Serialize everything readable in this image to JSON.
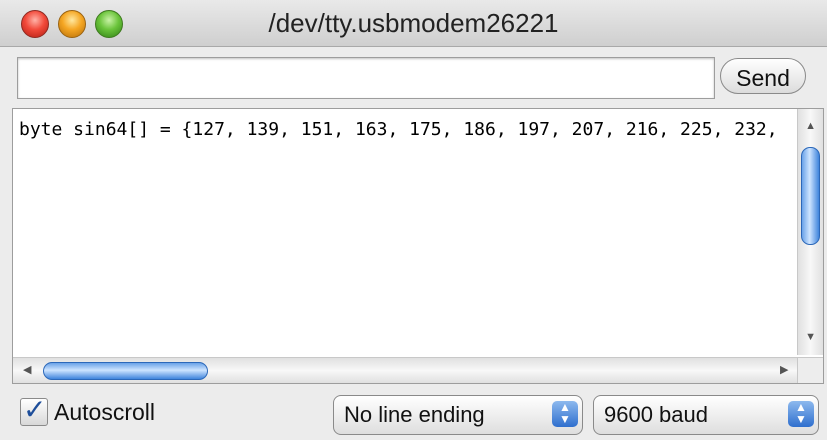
{
  "window": {
    "title": "/dev/tty.usbmodem26221"
  },
  "input": {
    "value": "",
    "placeholder": ""
  },
  "send_button": {
    "label": "Send"
  },
  "output": {
    "text": "byte sin64[] = {127, 139, 151, 163, 175, 186, 197, 207, 216, 225, 232,"
  },
  "autoscroll": {
    "label": "Autoscroll",
    "checked": true
  },
  "line_ending": {
    "value": "No line ending"
  },
  "baud": {
    "value": "9600 baud"
  },
  "icons": {
    "close": "close-traffic-light-icon",
    "minimize": "minimize-traffic-light-icon",
    "zoom": "zoom-traffic-light-icon"
  }
}
